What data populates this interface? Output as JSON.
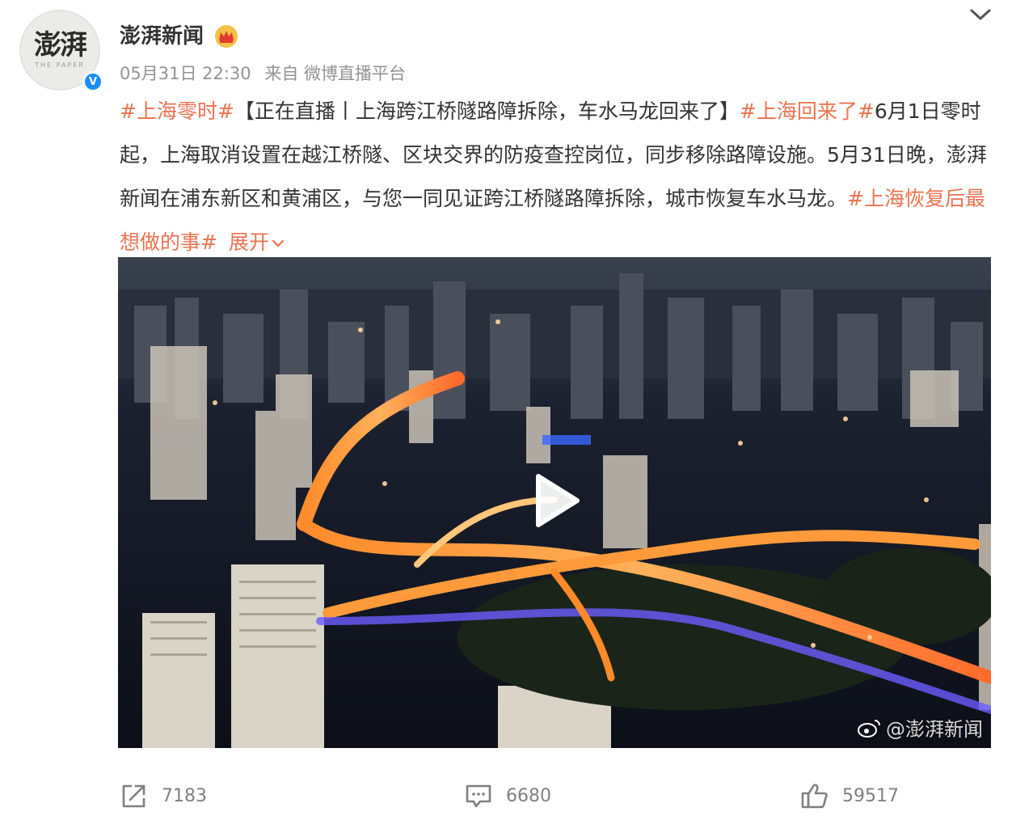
{
  "author": {
    "name": "澎湃新闻",
    "avatar_text": "澎湃",
    "avatar_subtext": "THE PAPER"
  },
  "meta": {
    "time": "05月31日 22:30",
    "source": "来自 微博直播平台"
  },
  "post": {
    "segments": [
      {
        "text": "#上海零时#",
        "tag": true
      },
      {
        "text": "【正在直播丨上海跨江桥隧路障拆除，车水马龙回来了】",
        "tag": false
      },
      {
        "text": "#上海回来了#",
        "tag": true
      },
      {
        "text": "6月1日零时起，上海取消设置在越江桥隧、区块交界的防疫查控岗位，同步移除路障设施。5月31日晚，澎湃新闻在浦东新区和黄浦区，与您一同见证跨江桥隧路障拆除，城市恢复车水马龙。",
        "tag": false
      },
      {
        "text": "#上海恢复后最想做的事#",
        "tag": true
      }
    ],
    "expand_label": "展开"
  },
  "media": {
    "watermark": "@澎湃新闻"
  },
  "actions": {
    "repost_count": "7183",
    "comment_count": "6680",
    "like_count": "59517"
  },
  "colors": {
    "tag": "#eb7350",
    "text": "#333333",
    "meta": "#939393",
    "verify": "#1a8cff"
  }
}
